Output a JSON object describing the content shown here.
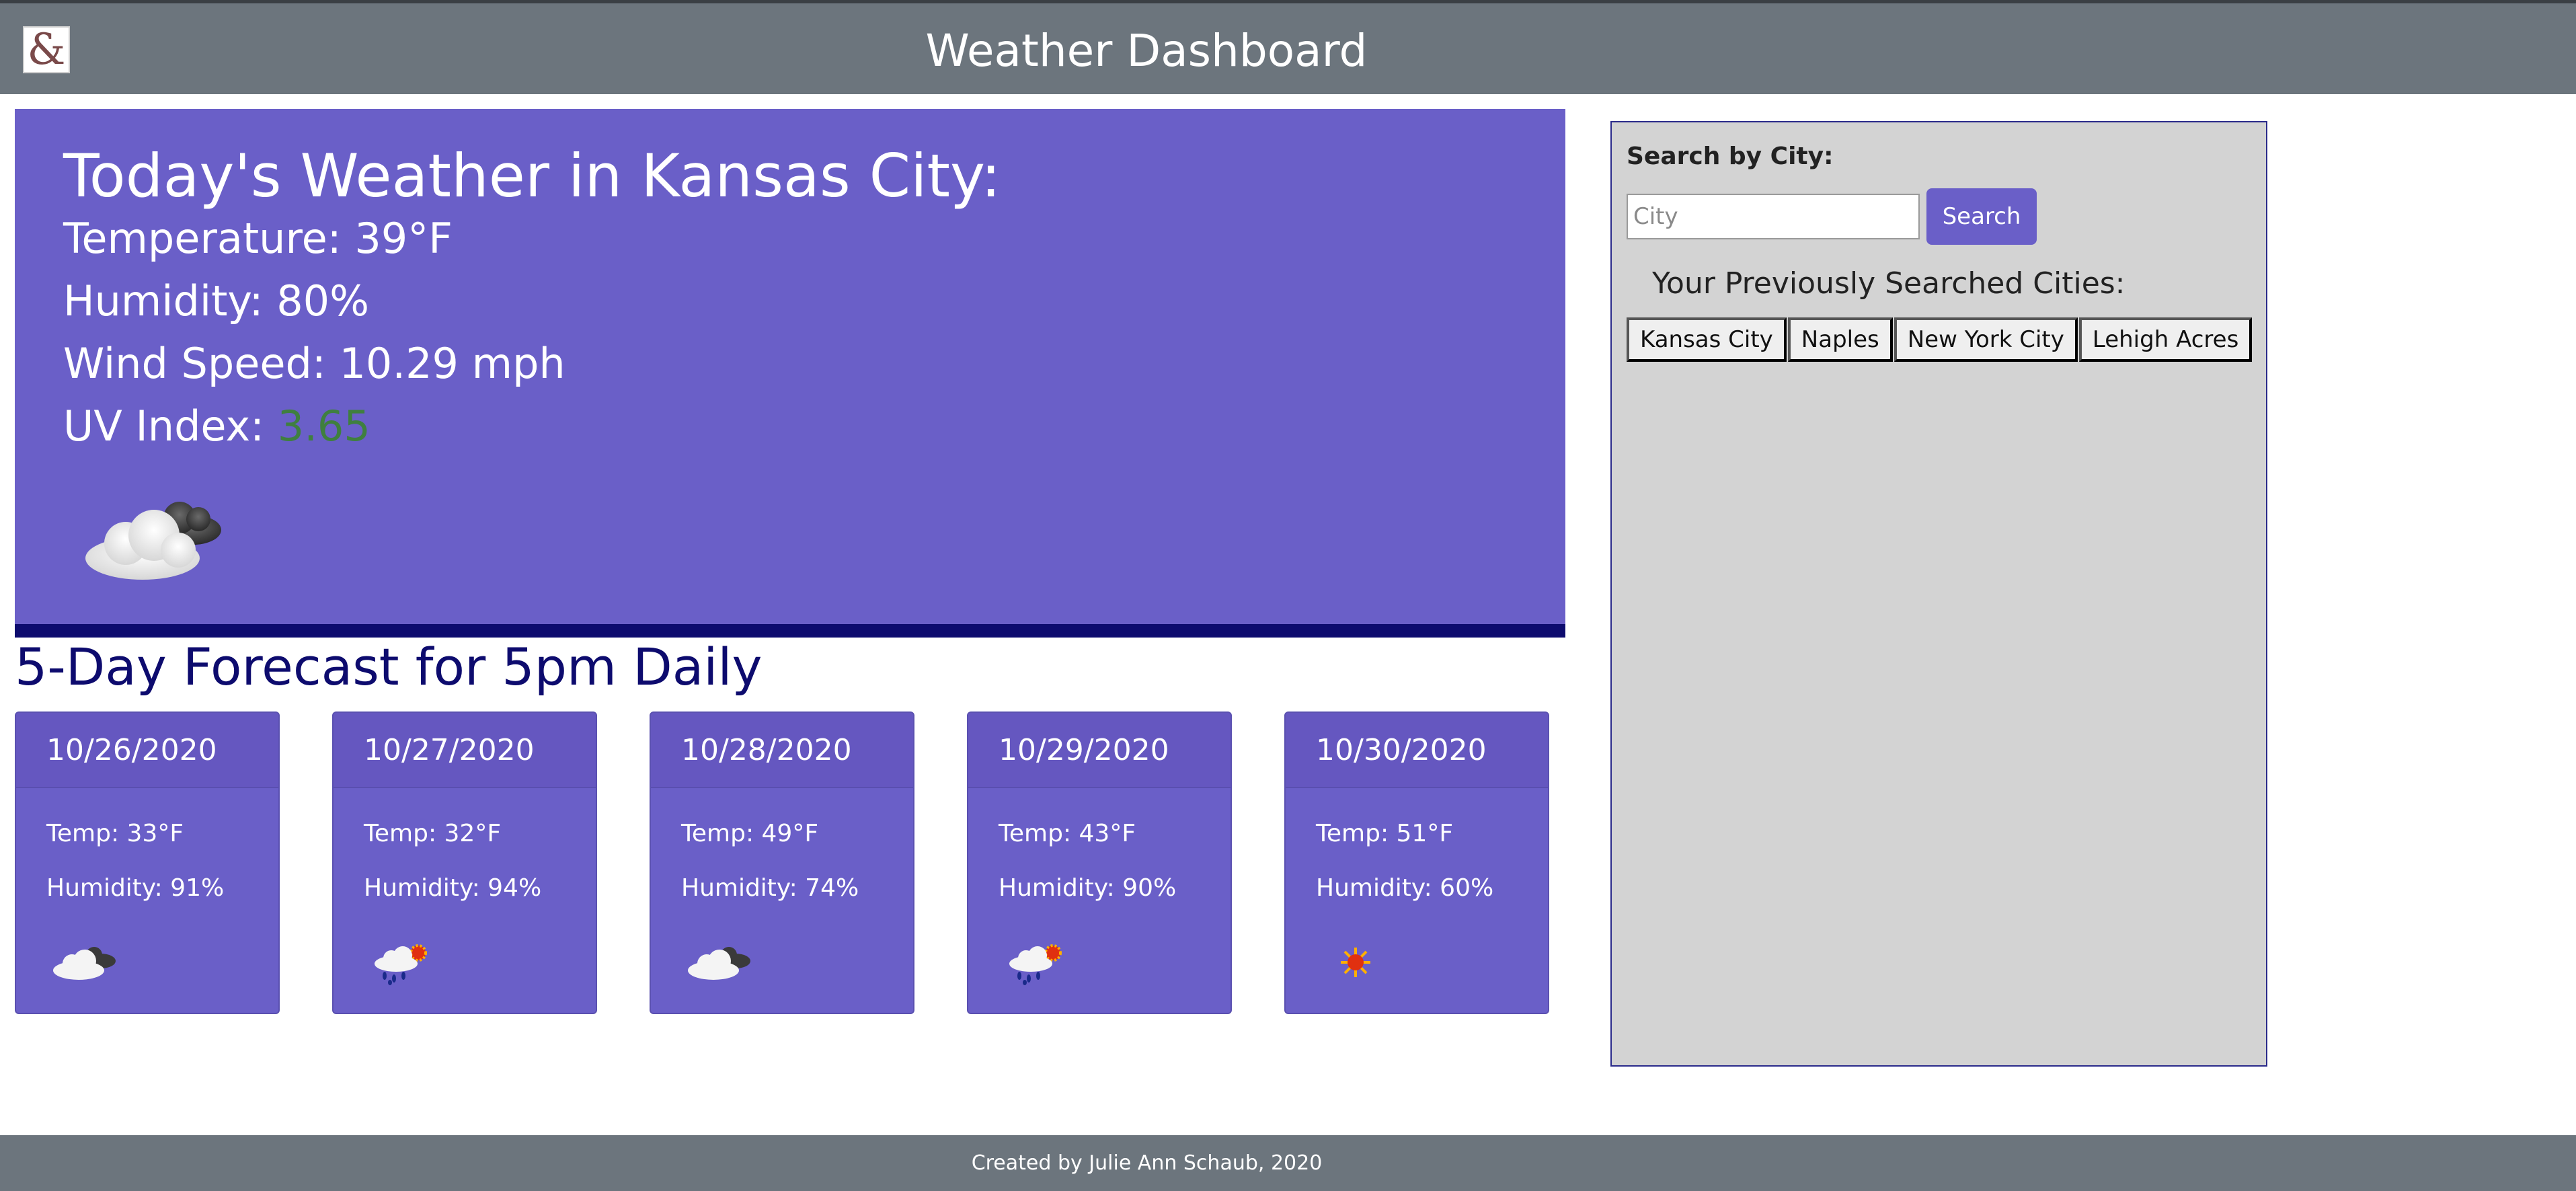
{
  "header": {
    "logo_glyph": "&",
    "title": "Weather Dashboard"
  },
  "current": {
    "title": "Today's Weather in Kansas City:",
    "temperature": "Temperature: 39°F",
    "humidity": "Humidity: 80%",
    "wind": "Wind Speed: 10.29 mph",
    "uv_label": "UV Index: ",
    "uv_value": "3.65",
    "uv_color": "#3f7f3f",
    "icon": "cloud-icon"
  },
  "forecast": {
    "title": "5-Day Forecast for 5pm Daily",
    "days": [
      {
        "date": "10/26/2020",
        "temp": "Temp: 33°F",
        "humidity": "Humidity: 91%",
        "icon": "cloud-icon"
      },
      {
        "date": "10/27/2020",
        "temp": "Temp: 32°F",
        "humidity": "Humidity: 94%",
        "icon": "rain-sun-icon"
      },
      {
        "date": "10/28/2020",
        "temp": "Temp: 49°F",
        "humidity": "Humidity: 74%",
        "icon": "cloud-icon"
      },
      {
        "date": "10/29/2020",
        "temp": "Temp: 43°F",
        "humidity": "Humidity: 90%",
        "icon": "rain-sun-icon"
      },
      {
        "date": "10/30/2020",
        "temp": "Temp: 51°F",
        "humidity": "Humidity: 60%",
        "icon": "sun-icon"
      }
    ]
  },
  "sidebar": {
    "search_label": "Search by City:",
    "search_placeholder": "City",
    "search_button": "Search",
    "previous_title": "Your Previously Searched Cities:",
    "cities": [
      "Kansas City",
      "Naples",
      "New York City",
      "Lehigh Acres"
    ]
  },
  "footer": {
    "text": "Created by Julie Ann Schaub, 2020"
  },
  "colors": {
    "header_bg": "#6c757d",
    "panel_bg": "#6a5fc8",
    "accent_navy": "#0d0b6e",
    "sidebar_bg": "#d3d3d3"
  }
}
